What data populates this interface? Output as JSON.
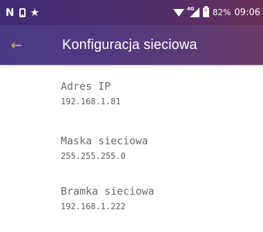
{
  "status_bar": {
    "left_icons": [
      "nfc-icon",
      "phone-icon",
      "star-icon"
    ],
    "network_type": "4G",
    "battery_percent": "82%",
    "time": "09:06"
  },
  "app_bar": {
    "back_icon": "back-arrow-icon",
    "title": "Konfiguracja sieciowa",
    "colors": {
      "accent": "#d9b24a",
      "bar_start": "#4a3a86",
      "bar_end": "#6c3a66"
    }
  },
  "settings": [
    {
      "label": "Adres IP",
      "value": "192.168.1.81"
    },
    {
      "label": "Maska sieciowa",
      "value": "255.255.255.0"
    },
    {
      "label": "Bramka sieciowa",
      "value": "192.168.1.222"
    }
  ]
}
